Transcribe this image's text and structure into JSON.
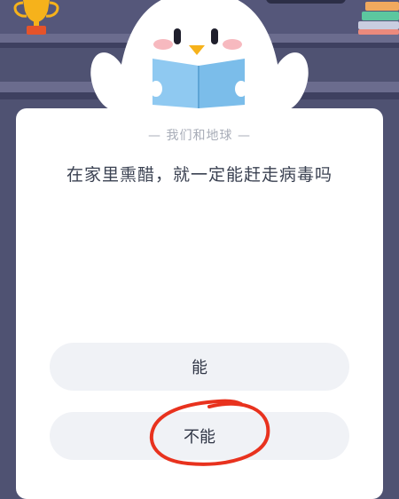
{
  "quiz": {
    "category": "— 我们和地球 —",
    "question": "在家里熏醋，就一定能赶走病毒吗",
    "options": [
      {
        "label": "能"
      },
      {
        "label": "不能"
      }
    ]
  },
  "icons": {
    "trophy": "trophy-icon",
    "books": "books-icon",
    "mascot": "penguin-mascot-reading-book"
  },
  "colors": {
    "background": "#4f5272",
    "shelf": "#6b6c8e",
    "card": "#ffffff",
    "option_bg": "#f0f2f6",
    "annotation_red": "#e8321e"
  }
}
